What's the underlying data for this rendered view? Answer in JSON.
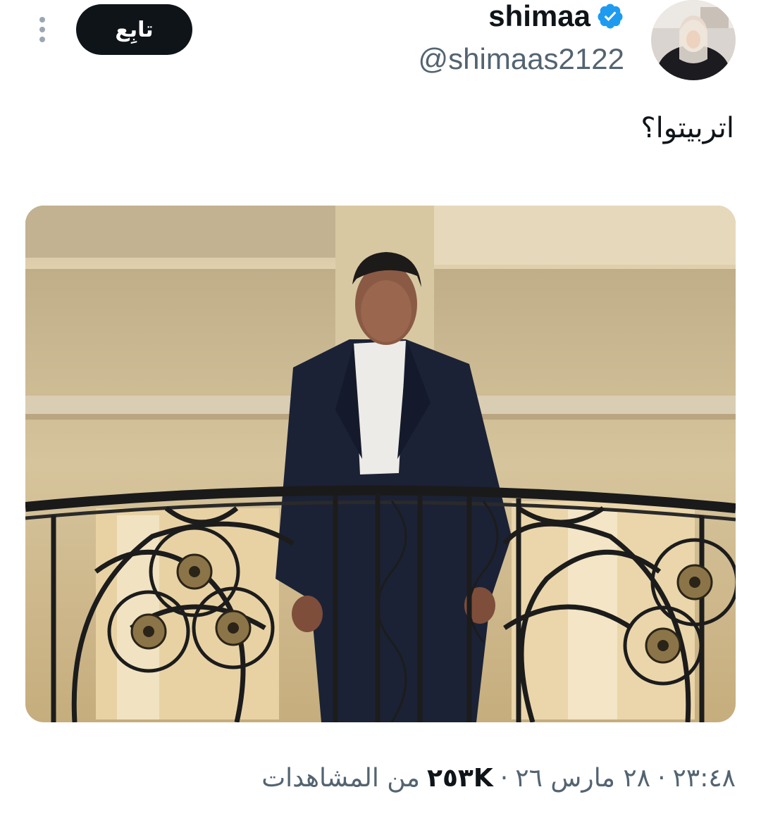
{
  "header": {
    "follow_label": "تابِع",
    "display_name": "shimaa",
    "handle": "@shimaas2122",
    "more_icon": "more-vertical-icon",
    "verified_icon": "verified-badge-icon",
    "verified_color": "#1d9bf0"
  },
  "tweet": {
    "text": "اتربيتوا؟"
  },
  "meta": {
    "time": "٢٣:٤٨",
    "separator": "·",
    "date": "٢٨ مارس ٢٦",
    "views_count": "٢٥٣K",
    "views_label": "من المشاهدات"
  },
  "colors": {
    "text_primary": "#0f1419",
    "text_secondary": "#536471",
    "button_bg": "#0f1419",
    "background": "#ffffff"
  }
}
